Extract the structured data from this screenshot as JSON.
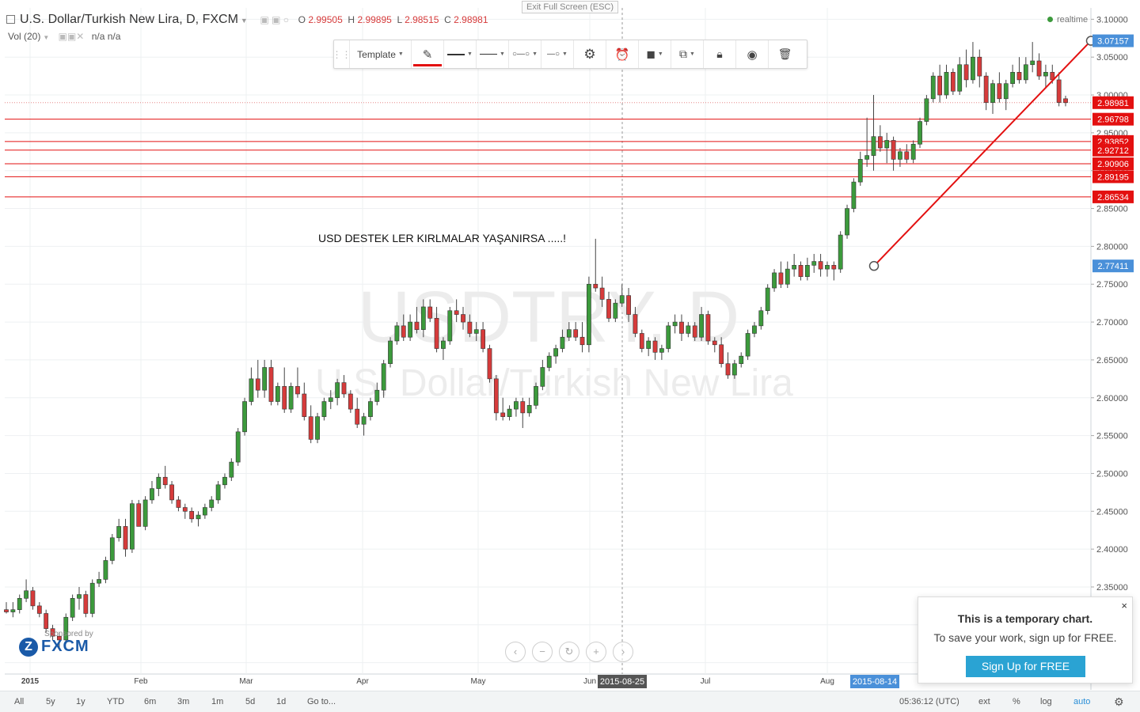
{
  "header": {
    "symbol": "U.S. Dollar/Turkish New Lira, D, FXCM",
    "o_label": "O",
    "o": "2.99505",
    "h_label": "H",
    "h": "2.99895",
    "l_label": "L",
    "l": "2.98515",
    "c_label": "C",
    "c": "2.98981",
    "vol": "Vol (20)",
    "vol_v1": "n/a",
    "vol_v2": "n/a",
    "realtime": "realtime",
    "exit_fullscreen": "Exit Full Screen (ESC)"
  },
  "watermark": {
    "line1": "USDTRY, D",
    "line2": "U.S. Dollar/Turkish New Lira"
  },
  "annotation": "USD DESTEK LER KIRLMALAR YAŞANIRSA .....!",
  "toolbar": {
    "template": "Template",
    "icons": [
      "pencil-icon",
      "line-style-icon",
      "line-width-icon",
      "line-dash-icon",
      "line-dot-icon",
      "settings-icon",
      "alert-icon",
      "bring-front-icon",
      "clone-icon",
      "lock-icon",
      "visibility-icon",
      "trash-icon"
    ]
  },
  "sponsor": {
    "label": "Sponsored by",
    "brand": "FXCM"
  },
  "popup": {
    "title": "This is a temporary chart.",
    "text": "To save your work, sign up for FREE.",
    "button": "Sign Up for FREE",
    "close": "×"
  },
  "bottombar": {
    "ranges": [
      "All",
      "5y",
      "1y",
      "YTD",
      "6m",
      "3m",
      "1m",
      "5d",
      "1d"
    ],
    "goto": "Go to...",
    "time": "05:36:12 (UTC)",
    "ext": "ext",
    "pct": "%",
    "log": "log",
    "auto": "auto"
  },
  "colors": {
    "up": "#3c9a3c",
    "down": "#d63b3b",
    "line": "#e31010",
    "price_tag": "#e31010",
    "blue_tag": "#4a90d9"
  },
  "chart_data": {
    "type": "candlestick",
    "y_axis_ticks": [
      "3.10000",
      "3.05000",
      "3.00000",
      "2.95000",
      "2.90000",
      "2.85000",
      "2.80000",
      "2.75000",
      "2.70000",
      "2.65000",
      "2.60000",
      "2.55000",
      "2.50000",
      "2.45000",
      "2.40000",
      "2.35000",
      "2.30000",
      "2.25000"
    ],
    "ylim": [
      2.235,
      3.115
    ],
    "x_axis_labels": [
      "2015",
      "Feb",
      "Mar",
      "Apr",
      "May",
      "Jun",
      "Jul",
      "Aug"
    ],
    "crosshair_x_label": "2015-08-25",
    "line_start_x_label": "2015-08-14",
    "current_price": "2.98981",
    "horizontal_lines": [
      "2.96798",
      "2.93852",
      "2.92712",
      "2.90906",
      "2.89195",
      "2.86534"
    ],
    "trend_line": {
      "start": "2.77411",
      "end": "3.07157"
    },
    "candles_ohlc": [
      [
        2.32,
        2.33,
        2.315,
        2.317
      ],
      [
        2.317,
        2.33,
        2.31,
        2.32
      ],
      [
        2.32,
        2.34,
        2.315,
        2.335
      ],
      [
        2.335,
        2.36,
        2.33,
        2.345
      ],
      [
        2.345,
        2.35,
        2.32,
        2.325
      ],
      [
        2.325,
        2.33,
        2.31,
        2.315
      ],
      [
        2.315,
        2.32,
        2.29,
        2.295
      ],
      [
        2.295,
        2.3,
        2.28,
        2.285
      ],
      [
        2.285,
        2.29,
        2.27,
        2.28
      ],
      [
        2.28,
        2.315,
        2.275,
        2.31
      ],
      [
        2.31,
        2.34,
        2.305,
        2.335
      ],
      [
        2.335,
        2.35,
        2.32,
        2.34
      ],
      [
        2.34,
        2.345,
        2.31,
        2.315
      ],
      [
        2.315,
        2.36,
        2.31,
        2.355
      ],
      [
        2.355,
        2.37,
        2.35,
        2.36
      ],
      [
        2.36,
        2.39,
        2.355,
        2.385
      ],
      [
        2.385,
        2.42,
        2.38,
        2.415
      ],
      [
        2.415,
        2.44,
        2.41,
        2.43
      ],
      [
        2.43,
        2.44,
        2.39,
        2.4
      ],
      [
        2.4,
        2.465,
        2.395,
        2.46
      ],
      [
        2.46,
        2.465,
        2.43,
        2.43
      ],
      [
        2.43,
        2.47,
        2.425,
        2.465
      ],
      [
        2.465,
        2.49,
        2.46,
        2.48
      ],
      [
        2.48,
        2.5,
        2.47,
        2.495
      ],
      [
        2.495,
        2.51,
        2.48,
        2.485
      ],
      [
        2.485,
        2.49,
        2.46,
        2.465
      ],
      [
        2.465,
        2.47,
        2.45,
        2.455
      ],
      [
        2.455,
        2.46,
        2.44,
        2.45
      ],
      [
        2.45,
        2.455,
        2.435,
        2.44
      ],
      [
        2.44,
        2.45,
        2.43,
        2.445
      ],
      [
        2.445,
        2.46,
        2.44,
        2.455
      ],
      [
        2.455,
        2.47,
        2.45,
        2.465
      ],
      [
        2.465,
        2.49,
        2.46,
        2.485
      ],
      [
        2.485,
        2.5,
        2.48,
        2.495
      ],
      [
        2.495,
        2.52,
        2.49,
        2.515
      ],
      [
        2.515,
        2.56,
        2.51,
        2.555
      ],
      [
        2.555,
        2.6,
        2.55,
        2.595
      ],
      [
        2.595,
        2.64,
        2.59,
        2.625
      ],
      [
        2.625,
        2.65,
        2.6,
        2.61
      ],
      [
        2.61,
        2.65,
        2.6,
        2.64
      ],
      [
        2.64,
        2.65,
        2.59,
        2.595
      ],
      [
        2.595,
        2.62,
        2.59,
        2.615
      ],
      [
        2.615,
        2.64,
        2.58,
        2.585
      ],
      [
        2.585,
        2.62,
        2.58,
        2.615
      ],
      [
        2.615,
        2.64,
        2.6,
        2.605
      ],
      [
        2.605,
        2.62,
        2.57,
        2.575
      ],
      [
        2.575,
        2.59,
        2.54,
        2.545
      ],
      [
        2.545,
        2.58,
        2.54,
        2.575
      ],
      [
        2.575,
        2.6,
        2.57,
        2.595
      ],
      [
        2.595,
        2.61,
        2.585,
        2.6
      ],
      [
        2.6,
        2.625,
        2.59,
        2.62
      ],
      [
        2.62,
        2.63,
        2.6,
        2.605
      ],
      [
        2.605,
        2.61,
        2.58,
        2.585
      ],
      [
        2.585,
        2.6,
        2.56,
        2.565
      ],
      [
        2.565,
        2.58,
        2.55,
        2.575
      ],
      [
        2.575,
        2.6,
        2.57,
        2.595
      ],
      [
        2.595,
        2.62,
        2.59,
        2.61
      ],
      [
        2.61,
        2.65,
        2.6,
        2.645
      ],
      [
        2.645,
        2.68,
        2.64,
        2.675
      ],
      [
        2.675,
        2.7,
        2.67,
        2.695
      ],
      [
        2.695,
        2.71,
        2.675,
        2.68
      ],
      [
        2.68,
        2.71,
        2.675,
        2.7
      ],
      [
        2.7,
        2.72,
        2.685,
        2.69
      ],
      [
        2.69,
        2.73,
        2.68,
        2.72
      ],
      [
        2.72,
        2.73,
        2.7,
        2.705
      ],
      [
        2.705,
        2.72,
        2.66,
        2.665
      ],
      [
        2.665,
        2.68,
        2.65,
        2.675
      ],
      [
        2.675,
        2.72,
        2.67,
        2.715
      ],
      [
        2.715,
        2.73,
        2.7,
        2.71
      ],
      [
        2.71,
        2.72,
        2.69,
        2.7
      ],
      [
        2.7,
        2.71,
        2.68,
        2.685
      ],
      [
        2.685,
        2.7,
        2.675,
        2.69
      ],
      [
        2.69,
        2.7,
        2.66,
        2.665
      ],
      [
        2.665,
        2.67,
        2.62,
        2.625
      ],
      [
        2.625,
        2.63,
        2.57,
        2.58
      ],
      [
        2.58,
        2.6,
        2.57,
        2.575
      ],
      [
        2.575,
        2.59,
        2.57,
        2.585
      ],
      [
        2.585,
        2.6,
        2.575,
        2.595
      ],
      [
        2.595,
        2.6,
        2.56,
        2.58
      ],
      [
        2.58,
        2.6,
        2.575,
        2.59
      ],
      [
        2.59,
        2.62,
        2.585,
        2.615
      ],
      [
        2.615,
        2.65,
        2.61,
        2.64
      ],
      [
        2.64,
        2.66,
        2.635,
        2.655
      ],
      [
        2.655,
        2.67,
        2.645,
        2.665
      ],
      [
        2.665,
        2.69,
        2.66,
        2.68
      ],
      [
        2.68,
        2.7,
        2.675,
        2.69
      ],
      [
        2.69,
        2.7,
        2.675,
        2.68
      ],
      [
        2.68,
        2.7,
        2.66,
        2.67
      ],
      [
        2.67,
        2.76,
        2.66,
        2.75
      ],
      [
        2.75,
        2.81,
        2.74,
        2.745
      ],
      [
        2.745,
        2.76,
        2.72,
        2.73
      ],
      [
        2.73,
        2.74,
        2.7,
        2.705
      ],
      [
        2.705,
        2.73,
        2.7,
        2.725
      ],
      [
        2.725,
        2.75,
        2.72,
        2.735
      ],
      [
        2.735,
        2.745,
        2.7,
        2.71
      ],
      [
        2.71,
        2.72,
        2.68,
        2.685
      ],
      [
        2.685,
        2.69,
        2.66,
        2.665
      ],
      [
        2.665,
        2.68,
        2.655,
        2.675
      ],
      [
        2.675,
        2.68,
        2.65,
        2.66
      ],
      [
        2.66,
        2.67,
        2.65,
        2.665
      ],
      [
        2.665,
        2.7,
        2.66,
        2.695
      ],
      [
        2.695,
        2.71,
        2.685,
        2.7
      ],
      [
        2.7,
        2.71,
        2.675,
        2.685
      ],
      [
        2.685,
        2.7,
        2.68,
        2.695
      ],
      [
        2.695,
        2.7,
        2.675,
        2.68
      ],
      [
        2.68,
        2.72,
        2.675,
        2.71
      ],
      [
        2.71,
        2.715,
        2.67,
        2.675
      ],
      [
        2.675,
        2.68,
        2.66,
        2.67
      ],
      [
        2.67,
        2.68,
        2.64,
        2.645
      ],
      [
        2.645,
        2.66,
        2.625,
        2.63
      ],
      [
        2.63,
        2.65,
        2.625,
        2.645
      ],
      [
        2.645,
        2.66,
        2.64,
        2.655
      ],
      [
        2.655,
        2.69,
        2.65,
        2.685
      ],
      [
        2.685,
        2.7,
        2.68,
        2.695
      ],
      [
        2.695,
        2.72,
        2.69,
        2.715
      ],
      [
        2.715,
        2.75,
        2.71,
        2.745
      ],
      [
        2.745,
        2.77,
        2.74,
        2.765
      ],
      [
        2.765,
        2.78,
        2.745,
        2.75
      ],
      [
        2.75,
        2.78,
        2.745,
        2.77
      ],
      [
        2.77,
        2.79,
        2.76,
        2.775
      ],
      [
        2.775,
        2.78,
        2.755,
        2.76
      ],
      [
        2.76,
        2.785,
        2.755,
        2.775
      ],
      [
        2.775,
        2.79,
        2.765,
        2.78
      ],
      [
        2.78,
        2.79,
        2.76,
        2.77
      ],
      [
        2.77,
        2.78,
        2.76,
        2.775
      ],
      [
        2.775,
        2.78,
        2.755,
        2.77
      ],
      [
        2.77,
        2.82,
        2.765,
        2.815
      ],
      [
        2.815,
        2.855,
        2.81,
        2.85
      ],
      [
        2.85,
        2.89,
        2.845,
        2.885
      ],
      [
        2.885,
        2.925,
        2.88,
        2.915
      ],
      [
        2.915,
        2.97,
        2.905,
        2.92
      ],
      [
        2.92,
        3.0,
        2.9,
        2.945
      ],
      [
        2.945,
        2.96,
        2.925,
        2.93
      ],
      [
        2.93,
        2.95,
        2.91,
        2.94
      ],
      [
        2.94,
        2.945,
        2.9,
        2.915
      ],
      [
        2.915,
        2.93,
        2.905,
        2.925
      ],
      [
        2.925,
        2.935,
        2.91,
        2.915
      ],
      [
        2.915,
        2.94,
        2.91,
        2.935
      ],
      [
        2.935,
        2.97,
        2.93,
        2.965
      ],
      [
        2.965,
        3.0,
        2.96,
        2.995
      ],
      [
        2.995,
        3.03,
        2.99,
        3.025
      ],
      [
        3.025,
        3.04,
        2.99,
        3.0
      ],
      [
        3.0,
        3.04,
        2.995,
        3.03
      ],
      [
        3.03,
        3.035,
        3.0,
        3.005
      ],
      [
        3.005,
        3.05,
        3.0,
        3.04
      ],
      [
        3.04,
        3.06,
        3.01,
        3.02
      ],
      [
        3.02,
        3.07,
        3.015,
        3.05
      ],
      [
        3.05,
        3.06,
        3.01,
        3.025
      ],
      [
        3.025,
        3.03,
        2.98,
        2.99
      ],
      [
        2.99,
        3.02,
        2.975,
        3.015
      ],
      [
        3.015,
        3.03,
        2.99,
        2.995
      ],
      [
        2.995,
        3.02,
        2.98,
        3.015
      ],
      [
        3.015,
        3.04,
        3.01,
        3.03
      ],
      [
        3.03,
        3.05,
        3.015,
        3.02
      ],
      [
        3.02,
        3.05,
        3.015,
        3.04
      ],
      [
        3.04,
        3.07,
        3.03,
        3.045
      ],
      [
        3.045,
        3.055,
        3.02,
        3.025
      ],
      [
        3.025,
        3.04,
        3.01,
        3.03
      ],
      [
        3.03,
        3.04,
        3.015,
        3.02
      ],
      [
        3.02,
        3.03,
        2.985,
        2.99
      ],
      [
        2.995,
        2.999,
        2.985,
        2.98981
      ]
    ]
  }
}
